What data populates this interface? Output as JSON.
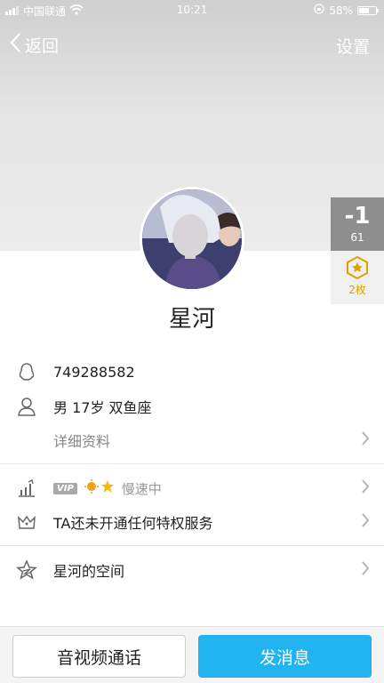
{
  "status_bar": {
    "carrier": "中国联通",
    "time": "10:21",
    "battery": "58%"
  },
  "nav": {
    "back_label": "返回",
    "settings_label": "设置"
  },
  "side_panel": {
    "likes_value": "-1",
    "likes_count": "61",
    "medal_count": "2枚"
  },
  "profile": {
    "nickname": "星河",
    "qq_number": "749288582",
    "basic_info": "男  17岁  双鱼座",
    "details_label": "详细资料"
  },
  "vip": {
    "tag": "VIP",
    "speed_label": "慢速中",
    "privilege_text": "TA还未开通任何特权服务"
  },
  "space": {
    "label": "星河的空间"
  },
  "actions": {
    "call_label": "音视频通话",
    "message_label": "发消息"
  },
  "colors": {
    "accent": "#21b4f0",
    "medal": "#e0a000"
  }
}
